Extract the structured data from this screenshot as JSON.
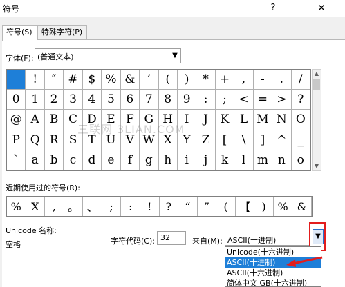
{
  "window": {
    "title": "符号",
    "help_icon": "?",
    "close_icon": "✕"
  },
  "tabs": [
    {
      "label": "符号(S)",
      "active": true
    },
    {
      "label": "特殊字符(P)",
      "active": false
    }
  ],
  "font": {
    "label": "字体(F):",
    "value": "(普通文本)"
  },
  "symbol_grid": {
    "rows": [
      [
        " ",
        "!",
        "″",
        "#",
        "$",
        "%",
        "&",
        "’",
        "(",
        ")",
        "*",
        "+",
        ",",
        "-",
        ".",
        "/"
      ],
      [
        "0",
        "1",
        "2",
        "3",
        "4",
        "5",
        "6",
        "7",
        "8",
        "9",
        ":",
        ";",
        "<",
        "=",
        ">",
        "?"
      ],
      [
        "@",
        "A",
        "B",
        "C",
        "D",
        "E",
        "F",
        "G",
        "H",
        "I",
        "J",
        "K",
        "L",
        "M",
        "N",
        "O"
      ],
      [
        "P",
        "Q",
        "R",
        "S",
        "T",
        "U",
        "V",
        "W",
        "X",
        "Y",
        "Z",
        "[",
        "\\",
        "]",
        "^",
        "_"
      ],
      [
        "`",
        "a",
        "b",
        "c",
        "d",
        "e",
        "f",
        "g",
        "h",
        "i",
        "j",
        "k",
        "l",
        "m",
        "n",
        "o"
      ]
    ],
    "selected": [
      0,
      0
    ]
  },
  "watermark": "三联网 3LIAN.COM",
  "recent": {
    "label": "近期使用过的符号(R):",
    "symbols": [
      "%",
      "X",
      ",",
      "。",
      "、",
      ";",
      ":",
      "!",
      "?",
      "“",
      "”",
      "(",
      "【",
      ")",
      "%",
      "&"
    ]
  },
  "unicode": {
    "label": "Unicode 名称:",
    "char_name": "空格"
  },
  "code": {
    "label": "字符代码(C):",
    "value": "32"
  },
  "from": {
    "label": "来自(M):",
    "value": "ASCII(十进制)",
    "options": [
      "Unicode(十六进制)",
      "ASCII(十进制)",
      "ASCII(十六进制)",
      "简体中文 GB(十六进制)"
    ],
    "highlighted": 1
  },
  "colors": {
    "selection": "#1e7fd8",
    "annotation": "#e21d1d"
  }
}
